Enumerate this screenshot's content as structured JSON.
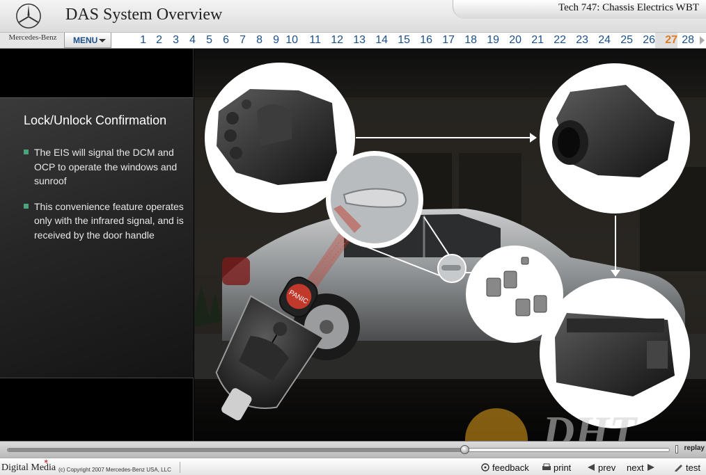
{
  "header": {
    "brand": "Mercedes-Benz",
    "app_title": "DAS System Overview",
    "course_title": "Tech 747: Chassis Electrics WBT"
  },
  "nav": {
    "menu_label": "MENU",
    "pages": [
      "1",
      "2",
      "3",
      "4",
      "5",
      "6",
      "7",
      "8",
      "9",
      "10",
      "11",
      "12",
      "13",
      "14",
      "15",
      "16",
      "17",
      "18",
      "19",
      "20",
      "21",
      "22",
      "23",
      "24",
      "25",
      "26",
      "27",
      "28"
    ],
    "current_page": "27",
    "current_color": "#e07a1f"
  },
  "slide": {
    "title": "Lock/Unlock Confirmation",
    "bullets": [
      "The EIS will signal the DCM and OCP to operate the windows and sunroof",
      "This convenience feature operates only with the infrared signal, and is received by the door handle"
    ],
    "key_button": "PANIC",
    "accent_color": "#4aa37a"
  },
  "watermark": "DHT",
  "player": {
    "progress": 0.69,
    "replay_label": "replay"
  },
  "footer": {
    "logo": "Digital Media",
    "copyright": "(c) Copyright 2007 Mercedes-Benz USA, LLC",
    "feedback_label": "feedback",
    "print_label": "print",
    "prev_label": "prev",
    "next_label": "next",
    "test_label": "test"
  }
}
